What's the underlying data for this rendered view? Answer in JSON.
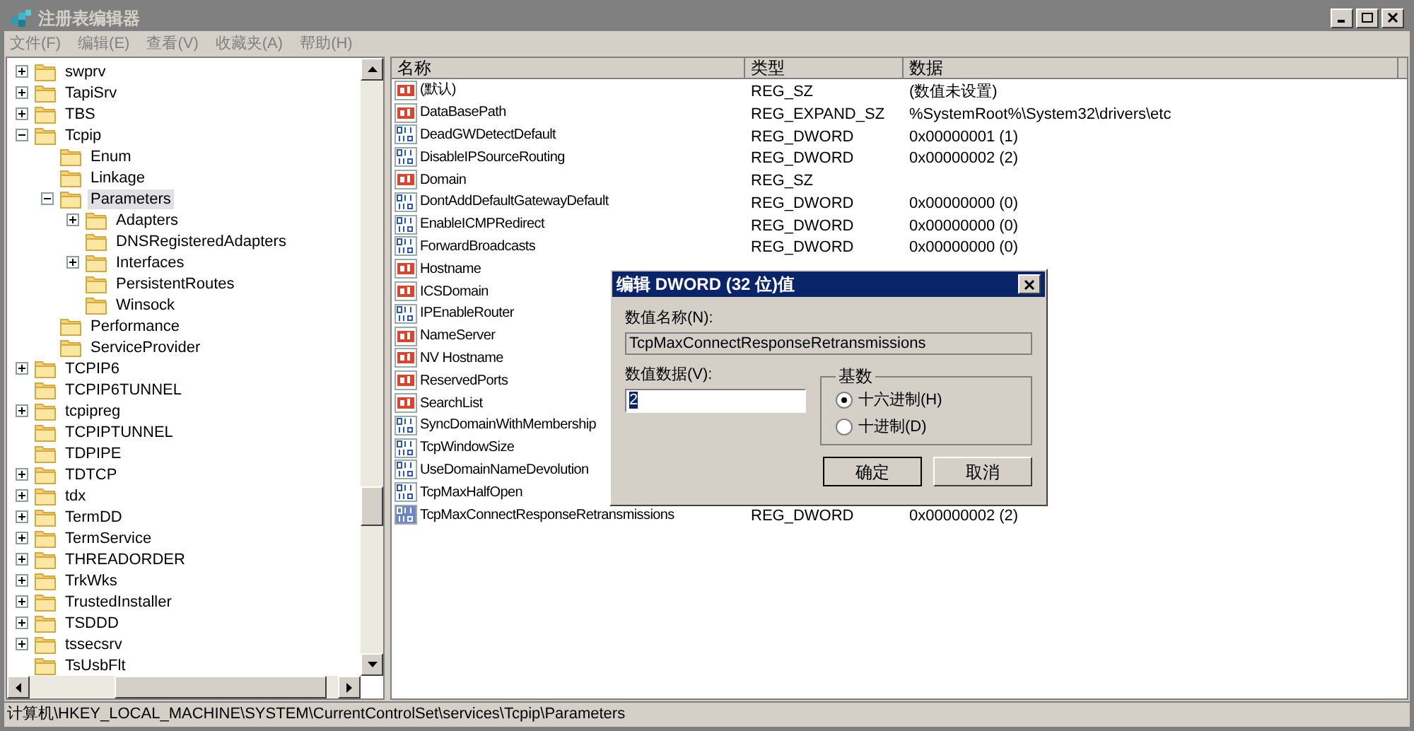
{
  "window": {
    "title": "注册表编辑器"
  },
  "menu": [
    "文件(F)",
    "编辑(E)",
    "查看(V)",
    "收藏夹(A)",
    "帮助(H)"
  ],
  "tree": [
    {
      "label": "swprv",
      "kind": "collapsed",
      "selected": false
    },
    {
      "label": "TapiSrv",
      "kind": "collapsed",
      "selected": false
    },
    {
      "label": "TBS",
      "kind": "collapsed",
      "selected": false
    },
    {
      "label": "Tcpip",
      "kind": "expanded",
      "selected": false,
      "children": [
        {
          "label": "Enum",
          "kind": "leaf",
          "selected": false
        },
        {
          "label": "Linkage",
          "kind": "leaf",
          "selected": false
        },
        {
          "label": "Parameters",
          "kind": "expanded",
          "selected": true,
          "children": [
            {
              "label": "Adapters",
              "kind": "collapsed",
              "selected": false
            },
            {
              "label": "DNSRegisteredAdapters",
              "kind": "leaf",
              "selected": false
            },
            {
              "label": "Interfaces",
              "kind": "collapsed",
              "selected": false
            },
            {
              "label": "PersistentRoutes",
              "kind": "leaf",
              "selected": false
            },
            {
              "label": "Winsock",
              "kind": "leaf",
              "selected": false
            }
          ]
        },
        {
          "label": "Performance",
          "kind": "leaf",
          "selected": false
        },
        {
          "label": "ServiceProvider",
          "kind": "leaf",
          "selected": false
        }
      ]
    },
    {
      "label": "TCPIP6",
      "kind": "collapsed",
      "selected": false
    },
    {
      "label": "TCPIP6TUNNEL",
      "kind": "leaf",
      "selected": false
    },
    {
      "label": "tcpipreg",
      "kind": "collapsed",
      "selected": false
    },
    {
      "label": "TCPIPTUNNEL",
      "kind": "leaf",
      "selected": false
    },
    {
      "label": "TDPIPE",
      "kind": "leaf",
      "selected": false
    },
    {
      "label": "TDTCP",
      "kind": "collapsed",
      "selected": false
    },
    {
      "label": "tdx",
      "kind": "collapsed",
      "selected": false
    },
    {
      "label": "TermDD",
      "kind": "collapsed",
      "selected": false
    },
    {
      "label": "TermService",
      "kind": "collapsed",
      "selected": false
    },
    {
      "label": "THREADORDER",
      "kind": "collapsed",
      "selected": false
    },
    {
      "label": "TrkWks",
      "kind": "collapsed",
      "selected": false
    },
    {
      "label": "TrustedInstaller",
      "kind": "collapsed",
      "selected": false
    },
    {
      "label": "TSDDD",
      "kind": "collapsed",
      "selected": false
    },
    {
      "label": "tssecsrv",
      "kind": "collapsed",
      "selected": false
    },
    {
      "label": "TsUsbFlt",
      "kind": "leaf",
      "selected": false
    }
  ],
  "values": {
    "columns": [
      "名称",
      "类型",
      "数据"
    ],
    "rows": [
      {
        "kind": "string",
        "name": "(默认)",
        "type": "REG_SZ",
        "data": "(数值未设置)",
        "selected": false
      },
      {
        "kind": "string",
        "name": "DataBasePath",
        "type": "REG_EXPAND_SZ",
        "data": "%SystemRoot%\\System32\\drivers\\etc",
        "selected": false
      },
      {
        "kind": "binary",
        "name": "DeadGWDetectDefault",
        "type": "REG_DWORD",
        "data": "0x00000001 (1)",
        "selected": false
      },
      {
        "kind": "binary",
        "name": "DisableIPSourceRouting",
        "type": "REG_DWORD",
        "data": "0x00000002 (2)",
        "selected": false
      },
      {
        "kind": "string",
        "name": "Domain",
        "type": "REG_SZ",
        "selected": false
      },
      {
        "kind": "binary",
        "name": "DontAddDefaultGatewayDefault",
        "type": "REG_DWORD",
        "data": "0x00000000 (0)",
        "selected": false
      },
      {
        "kind": "binary",
        "name": "EnableICMPRedirect",
        "type": "REG_DWORD",
        "data": "0x00000000 (0)",
        "selected": false
      },
      {
        "kind": "binary",
        "name": "ForwardBroadcasts",
        "type": "REG_DWORD",
        "data": "0x00000000 (0)",
        "selected": false
      },
      {
        "kind": "string",
        "name": "Hostname",
        "selected": false
      },
      {
        "kind": "string",
        "name": "ICSDomain",
        "selected": false
      },
      {
        "kind": "binary",
        "name": "IPEnableRouter",
        "selected": false
      },
      {
        "kind": "string",
        "name": "NameServer",
        "selected": false
      },
      {
        "kind": "string",
        "name": "NV Hostname",
        "selected": false
      },
      {
        "kind": "string",
        "name": "ReservedPorts",
        "selected": false
      },
      {
        "kind": "string",
        "name": "SearchList",
        "selected": false
      },
      {
        "kind": "binary",
        "name": "SyncDomainWithMembership",
        "selected": false
      },
      {
        "kind": "binary",
        "name": "TcpWindowSize",
        "selected": false
      },
      {
        "kind": "binary",
        "name": "UseDomainNameDevolution",
        "selected": false
      },
      {
        "kind": "binary",
        "name": "TcpMaxHalfOpen",
        "selected": false
      },
      {
        "kind": "binary",
        "name": "TcpMaxConnectResponseRetransmissions",
        "type": "REG_DWORD",
        "data": "0x00000002 (2)",
        "selected": true
      }
    ]
  },
  "dialog": {
    "title": "编辑 DWORD (32 位)值",
    "name_label": "数值名称(N):",
    "name_value": "TcpMaxConnectResponseRetransmissions",
    "data_label": "数值数据(V):",
    "data_value": "2",
    "base_title": "基数",
    "radios": [
      {
        "label": "十六进制(H)",
        "selected": true
      },
      {
        "label": "十进制(D)",
        "selected": false
      }
    ],
    "buttons": [
      "确定",
      "取消"
    ]
  },
  "status_bar": "计算机\\HKEY_LOCAL_MACHINE\\SYSTEM\\CurrentControlSet\\services\\Tcpip\\Parameters"
}
